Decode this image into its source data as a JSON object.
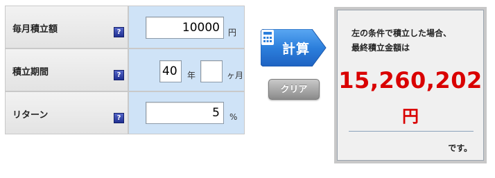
{
  "form": {
    "monthly": {
      "label": "毎月積立額",
      "help": "?",
      "value": "10000",
      "unit": "円"
    },
    "period": {
      "label": "積立期間",
      "help": "?",
      "years_value": "40",
      "years_unit": "年",
      "months_value": "",
      "months_unit": "ヶ月"
    },
    "return": {
      "label": "リターン",
      "help": "?",
      "value": "5",
      "unit": "%"
    }
  },
  "buttons": {
    "calculate_label": "計算",
    "clear_label": "クリア"
  },
  "result": {
    "line1": "左の条件で積立した場合、",
    "line2": "最終積立金額は",
    "amount": "15,260,202",
    "unit": "円",
    "suffix": "です。"
  },
  "colors": {
    "accent_blue": "#2b79d8",
    "result_red": "#d90000",
    "input_cell_bg": "#cfe3f7",
    "help_icon": "#2a3aa8"
  }
}
